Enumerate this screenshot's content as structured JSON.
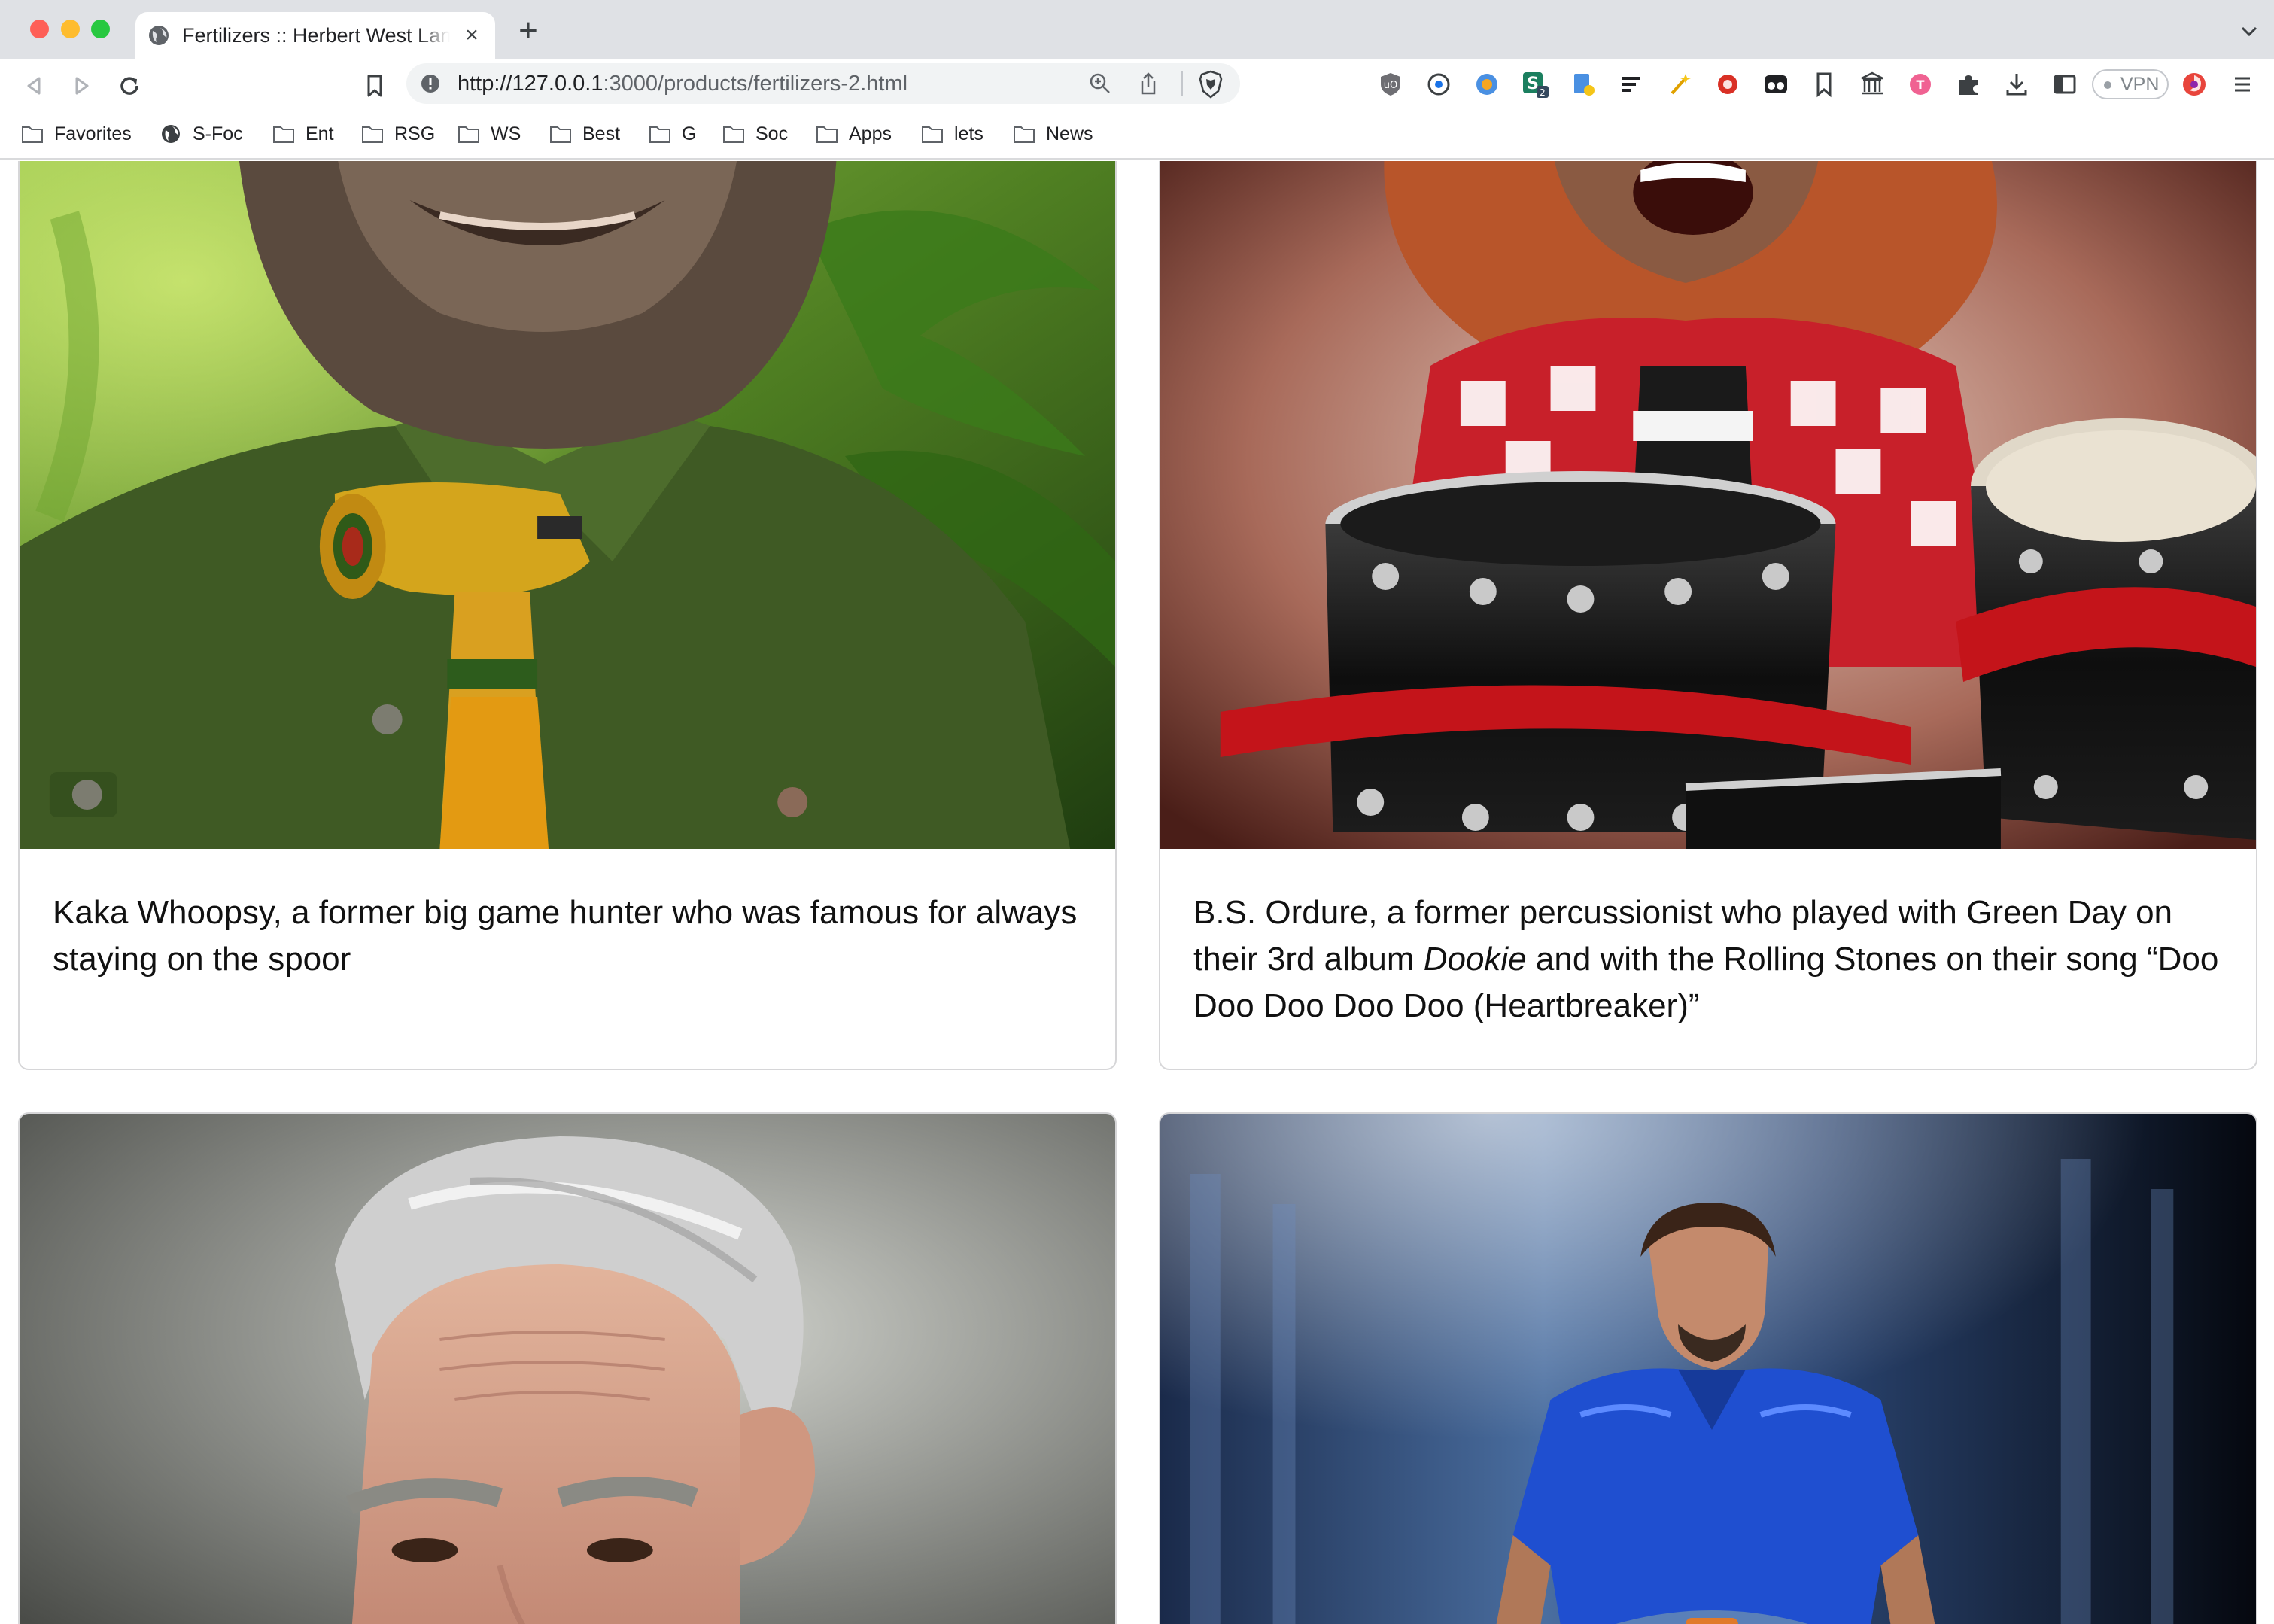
{
  "browser": {
    "tab_title": "Fertilizers :: Herbert West Landscaping",
    "url_host": "http://127.0.0.1",
    "url_path": ":3000/products/fertilizers-2.html",
    "vpn_label": "VPN",
    "bookmarks": [
      {
        "label": "Favorites",
        "icon": "folder-icon"
      },
      {
        "label": "S-Foc",
        "icon": "globe-icon"
      },
      {
        "label": "Ent",
        "icon": "folder-icon"
      },
      {
        "label": "RSG",
        "icon": "folder-icon"
      },
      {
        "label": "WS",
        "icon": "folder-icon"
      },
      {
        "label": "Best",
        "icon": "folder-icon"
      },
      {
        "label": "G",
        "icon": "folder-icon"
      },
      {
        "label": "Soc",
        "icon": "folder-icon"
      },
      {
        "label": "Apps",
        "icon": "folder-icon"
      },
      {
        "label": "lets",
        "icon": "folder-icon"
      },
      {
        "label": "News",
        "icon": "folder-icon"
      }
    ],
    "extensions": [
      "ublock-icon",
      "password-icon",
      "bird-icon",
      "seo-icon",
      "document-icon",
      "list-icon",
      "wand-icon",
      "record-icon",
      "glasses-icon",
      "bookmark-icon",
      "archive-icon",
      "translate-icon",
      "puzzle-icon",
      "download-icon",
      "sidebar-icon"
    ],
    "extension_badge": "2"
  },
  "cards": [
    {
      "caption": "Kaka Whoopsy, a former big game hunter who was famous for always staying on the spoor",
      "image": "jungle-hunter-portrait"
    },
    {
      "caption_before": "B.S. Ordure, a former percussionist who played with Green Day on their 3rd album ",
      "caption_em": "Dookie",
      "caption_after": " and with the Rolling Stones on their song “Doo Doo Doo Doo Doo (Heartbreaker)”",
      "image": "drummer-portrait"
    },
    {
      "caption": "",
      "image": "gray-haired-man-portrait"
    },
    {
      "caption": "",
      "image": "blue-shirt-rider-portrait"
    }
  ],
  "colors": {
    "accent": "#1a73e8",
    "card_border": "#d6d6d8",
    "chrome": "#dfe1e5"
  }
}
